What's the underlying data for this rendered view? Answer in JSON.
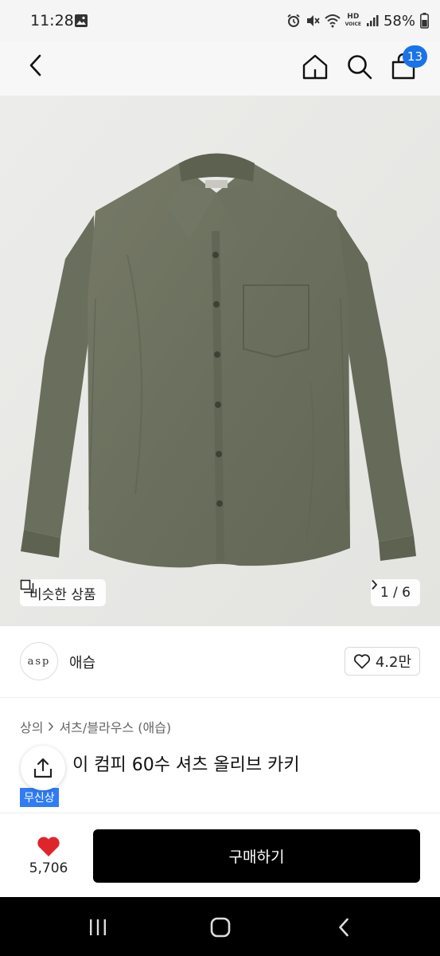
{
  "status_bar": {
    "time": "11:28",
    "battery": "58%",
    "hd_label": "HD",
    "hd_sub": "VOICE",
    "icons": [
      "image-icon",
      "alarm-icon",
      "mute-icon",
      "wifi-icon",
      "signal-icon",
      "battery-icon"
    ]
  },
  "header": {
    "cart_count": "13",
    "icons": [
      "back-icon",
      "home-icon",
      "search-icon",
      "cart-icon"
    ]
  },
  "gallery": {
    "similar_label": "비슷한 상품",
    "page_indicator": "1 / 6"
  },
  "brand": {
    "logo_text": "asp",
    "name": "애습",
    "like_count": "4.2만"
  },
  "product": {
    "breadcrumb": [
      "상의",
      "셔츠/블라우스 (애습)"
    ],
    "title_visible": "이 컴피 60수 셔츠 올리브 카키",
    "badge": "무신상"
  },
  "bottom": {
    "wish_count": "5,706",
    "buy_label": "구매하기"
  },
  "colors": {
    "accent": "#1a73e8",
    "badge_blue": "#2f7cf6",
    "heart_red": "#e0242b",
    "buy_black": "#000000",
    "shirt_olive": "#6e7260"
  }
}
